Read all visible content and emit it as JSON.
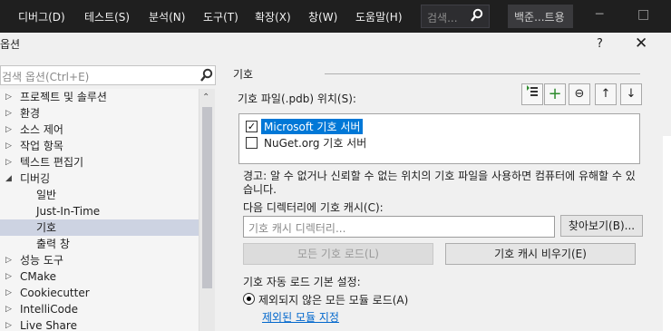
{
  "menubar": {
    "items": [
      "디버그(D)",
      "테스트(S)",
      "분석(N)",
      "도구(T)",
      "확장(X)",
      "창(W)",
      "도움말(H)"
    ],
    "search_placeholder": "검색...",
    "user_label": "백준...트용",
    "minimize": "─",
    "maximize": "□"
  },
  "dialog": {
    "title": "옵션",
    "help": "?",
    "close": "✕"
  },
  "sidebar": {
    "search_placeholder": "검색 옵션(Ctrl+E)",
    "items": [
      {
        "label": "프로젝트 및 솔루션",
        "arrow": "▷"
      },
      {
        "label": "환경",
        "arrow": "▷"
      },
      {
        "label": "소스 제어",
        "arrow": "▷"
      },
      {
        "label": "작업 항목",
        "arrow": "▷"
      },
      {
        "label": "텍스트 편집기",
        "arrow": "▷"
      },
      {
        "label": "디버깅",
        "arrow": "◢"
      },
      {
        "label": "일반",
        "arrow": ""
      },
      {
        "label": "Just-In-Time",
        "arrow": ""
      },
      {
        "label": "기호",
        "arrow": ""
      },
      {
        "label": "출력 창",
        "arrow": ""
      },
      {
        "label": "성능 도구",
        "arrow": "▷"
      },
      {
        "label": "CMake",
        "arrow": "▷"
      },
      {
        "label": "Cookiecutter",
        "arrow": "▷"
      },
      {
        "label": "IntelliCode",
        "arrow": "▷"
      },
      {
        "label": "Live Share",
        "arrow": "▷"
      }
    ],
    "selected": "기호"
  },
  "main": {
    "section_title": "기호",
    "symbol_files_label": "기호 파일(.pdb) 위치(S):",
    "toolbar": {
      "icons": [
        "import-icon",
        "add-icon",
        "remove-icon",
        "move-up-icon",
        "move-down-icon"
      ],
      "glyphs": [
        "⇶",
        "+",
        "⊖",
        "↑",
        "↓"
      ]
    },
    "servers": [
      {
        "label": "Microsoft 기호 서버",
        "checked": true,
        "selected": true
      },
      {
        "label": "NuGet.org 기호 서버",
        "checked": false,
        "selected": false
      }
    ],
    "warning": "경고: 알 수 없거나 신뢰할 수 없는 위치의 기호 파일을 사용하면 컴퓨터에 유해할 수 있습니다.",
    "cache_label": "다음 디렉터리에 기호 캐시(C):",
    "cache_placeholder": "기호 캐시 디렉터리...",
    "browse_button": "찾아보기(B)...",
    "load_all_button": "모든 기호 로드(L)",
    "empty_cache_button": "기호 캐시 비우기(E)",
    "auto_load_label": "기호 자동 로드 기본 설정:",
    "radio_label": "제외되지 않은 모든 모듈 로드(A)",
    "excluded_link": "제외된 모듈 지정"
  },
  "colors": {
    "menubar_bg": "#1f1f1f",
    "selection_bg": "#0078d7",
    "tree_selected_bg": "#cdd3e2",
    "link": "#0066cc"
  }
}
